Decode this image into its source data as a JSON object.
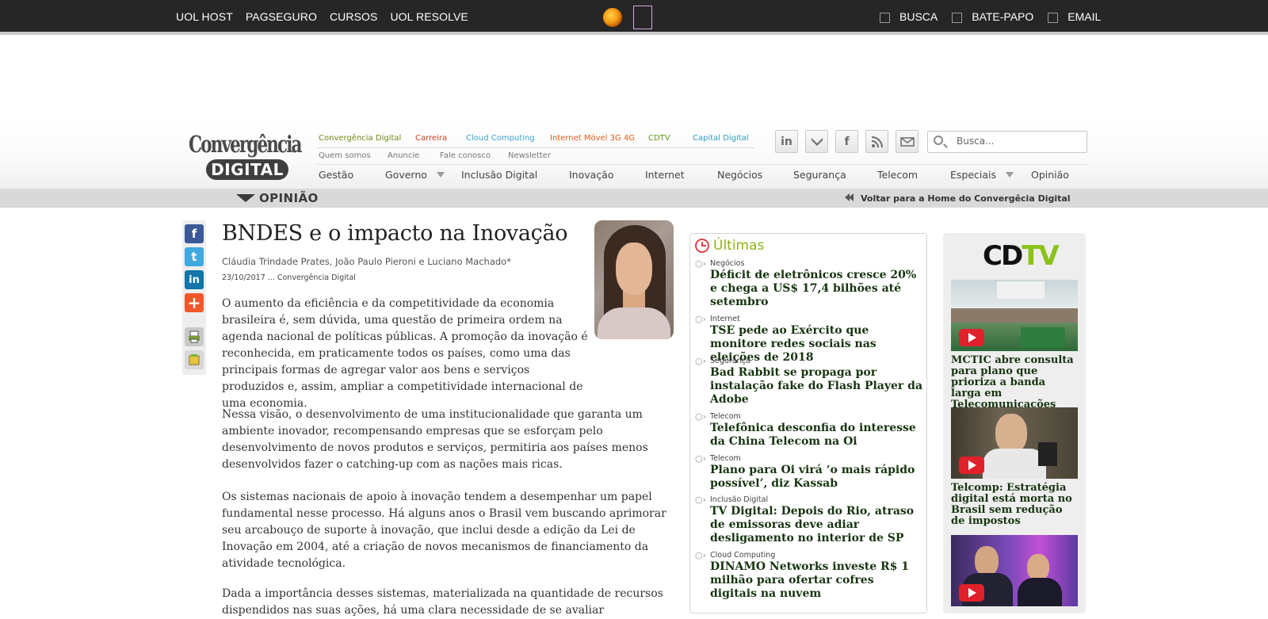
{
  "topbar": {
    "left_links": [
      "UOL HOST",
      "PAGSEGURO",
      "CURSOS",
      "UOL RESOLVE"
    ],
    "right_links": [
      "BUSCA",
      "BATE-PAPO",
      "EMAIL"
    ]
  },
  "masthead": {
    "logo_line1": "Convergência",
    "logo_line2": "DIGITAL",
    "sites": [
      {
        "label": "Convergência Digital",
        "color": "#6e8a14"
      },
      {
        "label": "Carreira",
        "color": "#c8421e"
      },
      {
        "label": "Cloud Computing",
        "color": "#3aa3d0"
      },
      {
        "label": "Internet Móvel 3G 4G",
        "color": "#e05a1a"
      },
      {
        "label": "CDTV",
        "color": "#5f9a16"
      },
      {
        "label": "Capital Digital",
        "color": "#2f9bc0"
      }
    ],
    "utility_links": [
      "Quem somos",
      "Anuncie",
      "Fale conosco",
      "Newsletter"
    ],
    "social_icons": [
      "linkedin-icon",
      "twitter-icon",
      "facebook-icon",
      "rss-icon",
      "email-icon"
    ],
    "search_placeholder": "Busca...",
    "nav": [
      "Gestão",
      "Governo",
      "Inclusão Digital",
      "Inovação",
      "Internet",
      "Negócios",
      "Segurança",
      "Telecom",
      "Especiais",
      "Opinião"
    ]
  },
  "section": {
    "title": "OPINIÃO",
    "back_link": "Voltar para a Home do Convergêcia Digital"
  },
  "share": {
    "icons": [
      "facebook-share-icon",
      "twitter-share-icon",
      "linkedin-share-icon",
      "more-share-icon",
      "print-icon",
      "save-note-icon"
    ],
    "colors": {
      "facebook": "#3b5998",
      "twitter": "#3fa9e0",
      "linkedin": "#0e76a8",
      "more": "#f2572b"
    }
  },
  "article": {
    "title": "BNDES e o impacto na Inovação",
    "authors": "Cláudia Trindade Prates, João Paulo Pieroni e Luciano Machado*",
    "meta": "23/10/2017 ... Convergência Digital",
    "p1": "O aumento da eficiência e da competitividade da economia brasileira é, sem dúvida, uma questão de primeira ordem na agenda nacional de políticas públicas. A promoção da inovação é reconhecida, em praticamente todos os países, como uma das principais formas de agregar valor aos bens e serviços produzidos e, assim, ampliar a competitividade internacional de uma economia.",
    "p2": "Nessa visão, o desenvolvimento de uma institucionalidade que garanta um ambiente inovador, recompensando empresas que se esforçam pelo desenvolvimento de novos produtos e serviços, permitiria aos países menos desenvolvidos fazer o catching-up com as nações mais ricas.",
    "p3": "Os sistemas nacionais de apoio à inovação tendem a desempenhar um papel fundamental nesse processo. Há alguns anos o Brasil vem buscando aprimorar seu arcabouço de suporte à inovação, que inclui desde a edição da Lei de Inovação em 2004, até a criação de novos mecanismos de financiamento da atividade tecnológica.",
    "p4": "Dada a importância desses sistemas, materializada na quantidade de recursos dispendidos nas suas ações, há uma clara necessidade de se avaliar"
  },
  "ultimas": {
    "title": "Últimas",
    "items": [
      {
        "category": "Negócios",
        "headline": "Déficit de eletrônicos cresce 20% e chega a US$ 17,4 bilhões até setembro"
      },
      {
        "category": "Internet",
        "headline": "TSE pede ao Exército que monitore redes sociais nas eleições de 2018"
      },
      {
        "category": "Segurança",
        "headline": "Bad Rabbit se propaga por instalação fake do Flash Player da Adobe"
      },
      {
        "category": "Telecom",
        "headline": "Telefônica desconfia do interesse da China Telecom na Oi"
      },
      {
        "category": "Telecom",
        "headline": "Plano para Oi virá ‘o mais rápido possível’, diz Kassab"
      },
      {
        "category": "Inclusão Digital",
        "headline": "TV Digital: Depois do Rio, atraso de emissoras deve adiar desligamento no interior de SP"
      },
      {
        "category": "Cloud Computing",
        "headline": "DINAMO Networks investe R$ 1 milhão para ofertar cofres digitais na nuvem"
      }
    ]
  },
  "cdtv": {
    "logo_cd": "CD",
    "logo_tv": "TV",
    "videos": [
      {
        "caption": "MCTIC abre consulta para plano que prioriza a banda larga em Telecomunicações"
      },
      {
        "caption": "Telcomp: Estratégia digital está morta no Brasil sem redução de impostos"
      },
      {
        "caption": ""
      }
    ]
  }
}
